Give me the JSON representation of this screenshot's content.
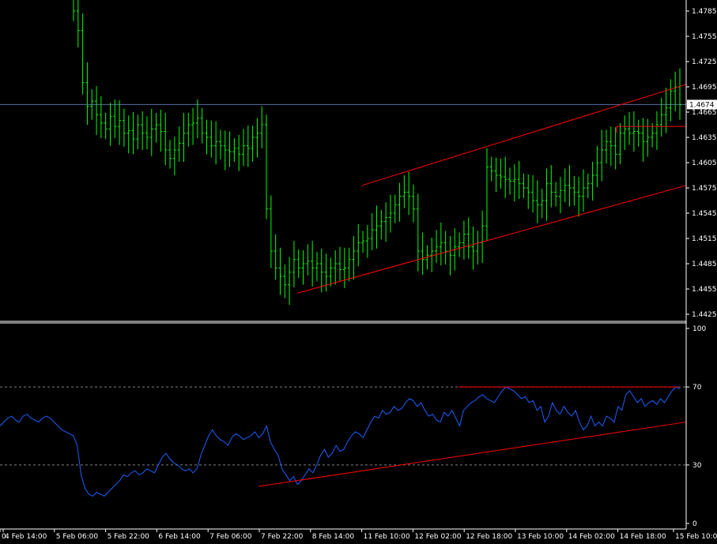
{
  "colors": {
    "background": "#000000",
    "price_bars": "#00ff00",
    "rsi_line": "#1e5eff",
    "trendlines": "#ff0000",
    "current_price_line": "#5a6ea8",
    "axes": "#ffffff",
    "rsi_levels": "#808080"
  },
  "price_axis": {
    "ticks": [
      "1.4785",
      "1.4755",
      "1.4725",
      "1.4695",
      "1.4665",
      "1.4635",
      "1.4605",
      "1.4575",
      "1.4545",
      "1.4515",
      "1.4485",
      "1.4455",
      "1.4425"
    ],
    "current_price": "1.4674"
  },
  "rsi_axis": {
    "ticks": [
      "100",
      "70",
      "30",
      "0"
    ]
  },
  "time_axis": {
    "labels": [
      "0",
      "4 Feb 14:00",
      "5 Feb 06:00",
      "5 Feb 22:00",
      "6 Feb 14:00",
      "7 Feb 06:00",
      "7 Feb 22:00",
      "8 Feb 14:00",
      "11 Feb 10:00",
      "12 Feb 02:00",
      "12 Feb 18:00",
      "13 Feb 10:00",
      "14 Feb 02:00",
      "14 Feb 18:00",
      "15 Feb 10:00"
    ]
  },
  "chart_data": [
    {
      "type": "bar",
      "subtype": "ohlc",
      "ylim": [
        1.4418,
        1.48
      ],
      "scale": "linear",
      "grid": false,
      "series": [
        {
          "close": [
            1.4785,
            1.4762,
            1.47,
            1.4672,
            1.4678,
            1.4662,
            1.4652,
            1.4645,
            1.466,
            1.4648,
            1.4655,
            1.464,
            1.4643,
            1.4633,
            1.465,
            1.464,
            1.4635,
            1.4645,
            1.465,
            1.4642,
            1.462,
            1.461,
            1.462,
            1.4628,
            1.464,
            1.465,
            1.4652,
            1.4658,
            1.464,
            1.4635,
            1.4625,
            1.463,
            1.4625,
            1.462,
            1.4618,
            1.4622,
            1.4615,
            1.4625,
            1.4622,
            1.4635,
            1.464,
            1.465,
            1.455,
            1.45,
            1.448,
            1.447,
            1.446,
            1.4475,
            1.449,
            1.448,
            1.4485,
            1.4488,
            1.448,
            1.4485,
            1.4475,
            1.447,
            1.448,
            1.4485,
            1.4478,
            1.448,
            1.449,
            1.45,
            1.451,
            1.4512,
            1.4515,
            1.4525,
            1.453,
            1.4535,
            1.454,
            1.4545,
            1.4555,
            1.4565,
            1.457,
            1.4565,
            1.455,
            1.45,
            1.449,
            1.4495,
            1.45,
            1.4505,
            1.451,
            1.45,
            1.4495,
            1.4505,
            1.451,
            1.452,
            1.4505,
            1.45,
            1.451,
            1.453,
            1.46,
            1.4595,
            1.459,
            1.4588,
            1.4585,
            1.4583,
            1.4585,
            1.458,
            1.4575,
            1.457,
            1.456,
            1.4555,
            1.456,
            1.458,
            1.457,
            1.4565,
            1.4572,
            1.4578,
            1.4575,
            1.457,
            1.4565,
            1.4575,
            1.458,
            1.459,
            1.4605,
            1.462,
            1.463,
            1.4625,
            1.4615,
            1.464,
            1.4645,
            1.464,
            1.4642,
            1.464,
            1.463,
            1.4635,
            1.464,
            1.465,
            1.4662,
            1.467,
            1.469,
            1.4695,
            1.4674
          ],
          "high_low_note": "intrabar high/low ranges drawn per bar"
        }
      ]
    },
    {
      "type": "line",
      "ylim": [
        0,
        100
      ],
      "levels": [
        70,
        30
      ],
      "series": [
        {
          "values": [
            50,
            52,
            54,
            55,
            53,
            52,
            55,
            56,
            54,
            53,
            52,
            54,
            55,
            54,
            52,
            50,
            48,
            47,
            46,
            45,
            40,
            25,
            18,
            15,
            14,
            16,
            15,
            14,
            16,
            18,
            20,
            22,
            25,
            24,
            26,
            27,
            25,
            26,
            28,
            27,
            26,
            30,
            34,
            36,
            33,
            31,
            30,
            28,
            27,
            28,
            26,
            28,
            35,
            40,
            45,
            48,
            45,
            43,
            42,
            40,
            44,
            46,
            45,
            43,
            44,
            45,
            47,
            44,
            46,
            50,
            42,
            38,
            35,
            28,
            25,
            22,
            24,
            20,
            22,
            25,
            28,
            26,
            30,
            35,
            38,
            34,
            36,
            40,
            37,
            38,
            42,
            45,
            47,
            46,
            44,
            48,
            52,
            55,
            54,
            58,
            56,
            57,
            60,
            58,
            59,
            62,
            64,
            63,
            60,
            62,
            58,
            55,
            56,
            53,
            52,
            57,
            55,
            58,
            54,
            50,
            58,
            60,
            62,
            63,
            65,
            66,
            64,
            63,
            62,
            65,
            68,
            70,
            69,
            68,
            66,
            64,
            65,
            62,
            63,
            58,
            60,
            52,
            55,
            62,
            58,
            56,
            60,
            57,
            55,
            58,
            52,
            48,
            50,
            55,
            50,
            52,
            50,
            55,
            54,
            52,
            60,
            58,
            66,
            68,
            65,
            62,
            64,
            60,
            62,
            63,
            61,
            64,
            62,
            65,
            68,
            70,
            69
          ],
          "trendlines": true
        }
      ]
    }
  ]
}
